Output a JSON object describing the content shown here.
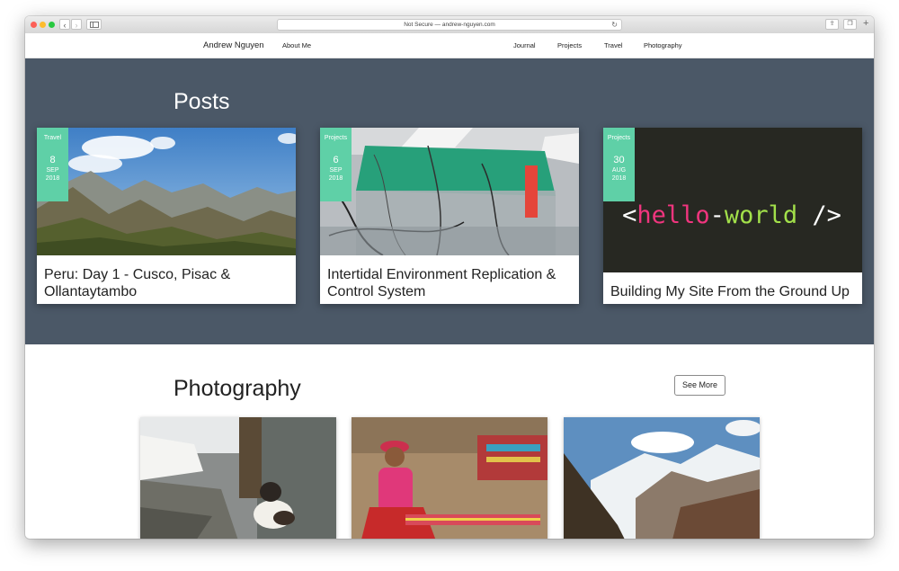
{
  "browser": {
    "url_text": "Not Secure — andrew-nguyen.com",
    "nav_back": "‹",
    "nav_forward": "›",
    "reload": "↻",
    "share": "⇪",
    "tabs": "❐",
    "new_tab": "+"
  },
  "site_nav": {
    "brand": "Andrew Nguyen",
    "about": "About Me",
    "links": [
      "Journal",
      "Projects",
      "Travel",
      "Photography"
    ]
  },
  "posts": {
    "heading": "Posts",
    "items": [
      {
        "category": "Travel",
        "day": "8",
        "month": "SEP",
        "year": "2018",
        "title": "Peru: Day 1 - Cusco, Pisac & Ollantaytambo"
      },
      {
        "category": "Projects",
        "day": "6",
        "month": "SEP",
        "year": "2018",
        "title": "Intertidal Environment Replication & Control System"
      },
      {
        "category": "Projects",
        "day": "30",
        "month": "AUG",
        "year": "2018",
        "title": "Building My Site From the Ground Up",
        "image_text": {
          "open": "<",
          "hello": "hello",
          "dash": "-",
          "world": "world",
          "close": " />"
        }
      }
    ]
  },
  "photography": {
    "heading": "Photography",
    "see_more": "See More"
  },
  "colors": {
    "posts_bg": "#4b5867",
    "tag_bg": "#5fd0a7",
    "code_pink": "#f0357e",
    "code_green": "#a2e04a"
  }
}
